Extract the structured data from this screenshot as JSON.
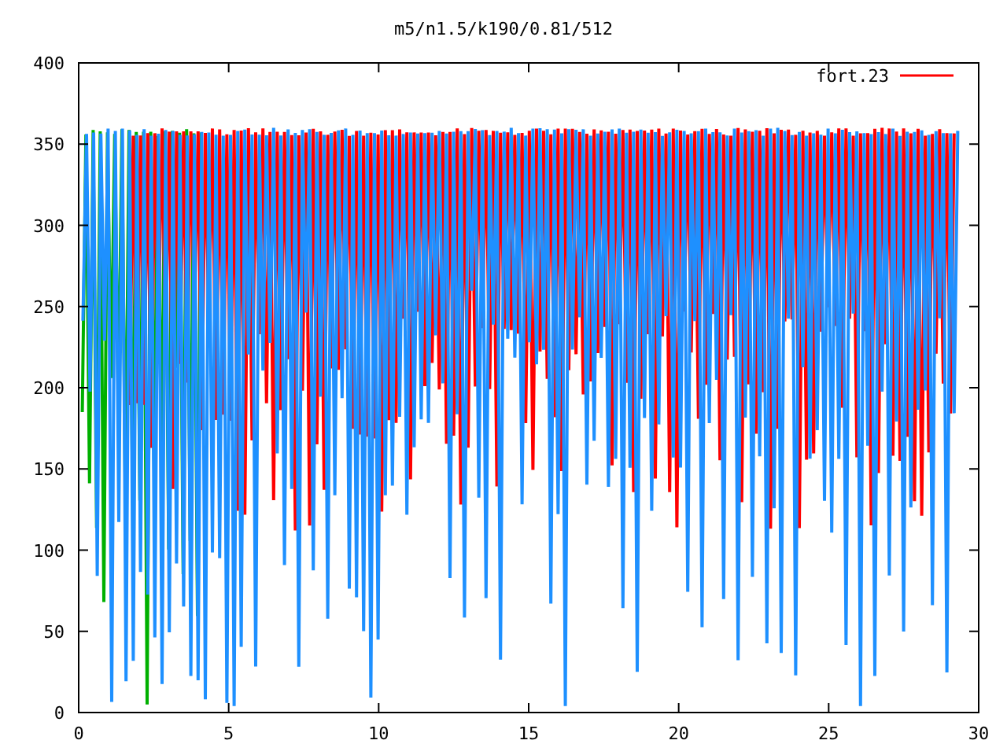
{
  "title": "m5/n1.5/k190/0.81/512",
  "y_ticks": [
    "400",
    "350",
    "300",
    "250",
    "200",
    "150",
    "100",
    "50",
    "0"
  ],
  "x_ticks": [
    "0",
    "5",
    "10",
    "15",
    "20",
    "25",
    "30"
  ],
  "legend": {
    "label": "fort.23"
  }
}
